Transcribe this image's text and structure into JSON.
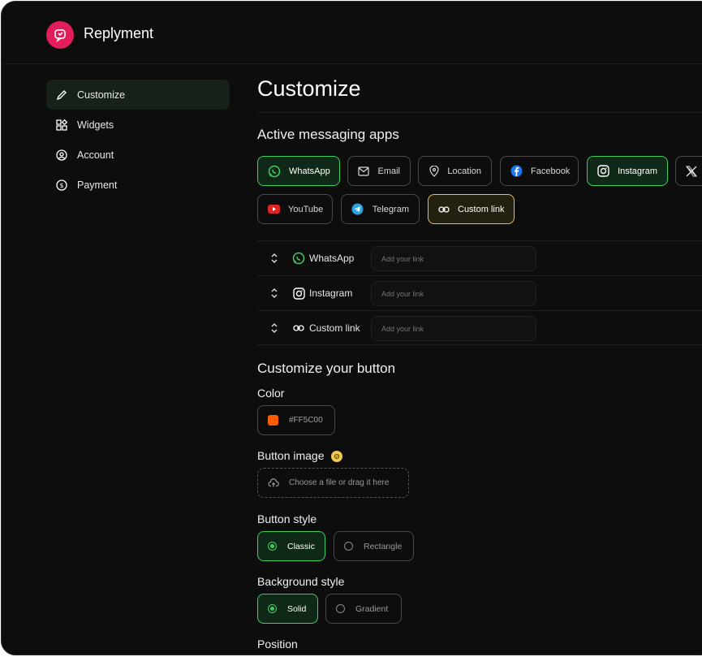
{
  "brand": {
    "name": "Replyment",
    "color": "#e11d5a"
  },
  "sidebar": {
    "items": [
      {
        "label": "Customize",
        "icon": "pencil-icon",
        "active": true
      },
      {
        "label": "Widgets",
        "icon": "widgets-icon",
        "active": false
      },
      {
        "label": "Account",
        "icon": "user-circle-icon",
        "active": false
      },
      {
        "label": "Payment",
        "icon": "dollar-circle-icon",
        "active": false
      }
    ]
  },
  "main": {
    "title": "Customize",
    "active_apps": {
      "heading": "Active messaging apps",
      "chips": [
        {
          "label": "WhatsApp",
          "icon": "whatsapp-icon",
          "state": "selected"
        },
        {
          "label": "Email",
          "icon": "mail-icon",
          "state": "default"
        },
        {
          "label": "Location",
          "icon": "location-pin-icon",
          "state": "default"
        },
        {
          "label": "Facebook",
          "icon": "facebook-icon",
          "state": "default"
        },
        {
          "label": "Instagram",
          "icon": "instagram-icon",
          "state": "selected"
        },
        {
          "label": "",
          "icon": "x-icon",
          "state": "default"
        },
        {
          "label": "YouTube",
          "icon": "youtube-icon",
          "state": "default"
        },
        {
          "label": "Telegram",
          "icon": "telegram-icon",
          "state": "default"
        },
        {
          "label": "Custom link",
          "icon": "link-icon",
          "state": "highlighted"
        }
      ],
      "links": [
        {
          "name": "WhatsApp",
          "icon": "whatsapp-icon",
          "placeholder": "Add your link"
        },
        {
          "name": "Instagram",
          "icon": "instagram-icon",
          "placeholder": "Add your link"
        },
        {
          "name": "Custom link",
          "icon": "link-icon",
          "placeholder": "Add your link"
        }
      ]
    },
    "button": {
      "heading": "Customize your button",
      "color_label": "Color",
      "color_value": "#FF5C00",
      "image_label": "Button image",
      "upload_text": "Choose a file or drag it here",
      "style_label": "Button style",
      "styles": [
        {
          "label": "Classic",
          "selected": true
        },
        {
          "label": "Rectangle",
          "selected": false
        }
      ],
      "bg_label": "Background style",
      "backgrounds": [
        {
          "label": "Solid",
          "selected": true
        },
        {
          "label": "Gradient",
          "selected": false
        }
      ],
      "position_label": "Position"
    }
  },
  "colors": {
    "accent_green": "#3ecf63",
    "accent_yellow": "#e7c24b",
    "background": "#0d0d0d"
  }
}
